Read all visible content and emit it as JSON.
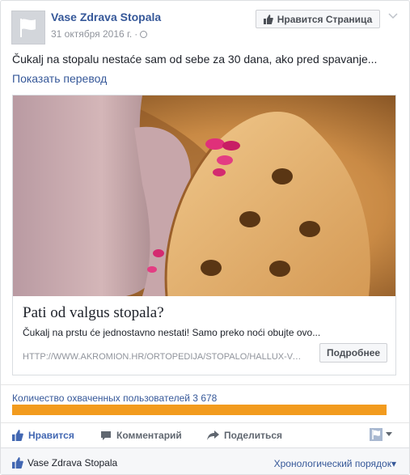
{
  "header": {
    "page_name": "Vase Zdrava Stopala",
    "date": "31 октября 2016 г.",
    "separator": "·",
    "like_page_label": "Нравится Страница"
  },
  "post": {
    "text": "Čukalj na stopalu nestaće sam od sebe za 30 dana, ako pred spavanje...",
    "see_translation": "Показать перевод"
  },
  "attachment": {
    "title": "Pati od valgus stopala?",
    "description": "Čukalj na prstu će jednostavno nestati! Samo preko noći obujte ovo...",
    "domain": "HTTP://WWW.AKROMION.HR/ORTOPEDIJA/STOPALO/HALLUX-VALGUS",
    "button_label": "Подробнее"
  },
  "reach": {
    "label": "Количество охваченных пользователей 3 678",
    "fill_percent": 100,
    "color": "#f29b1e"
  },
  "actions": {
    "like": "Нравится",
    "comment": "Комментарий",
    "share": "Поделиться"
  },
  "footer": {
    "name": "Vase Zdrava Stopala",
    "order": "Хронологический порядок"
  },
  "colors": {
    "link": "#365899",
    "like_active": "#4267b2"
  }
}
